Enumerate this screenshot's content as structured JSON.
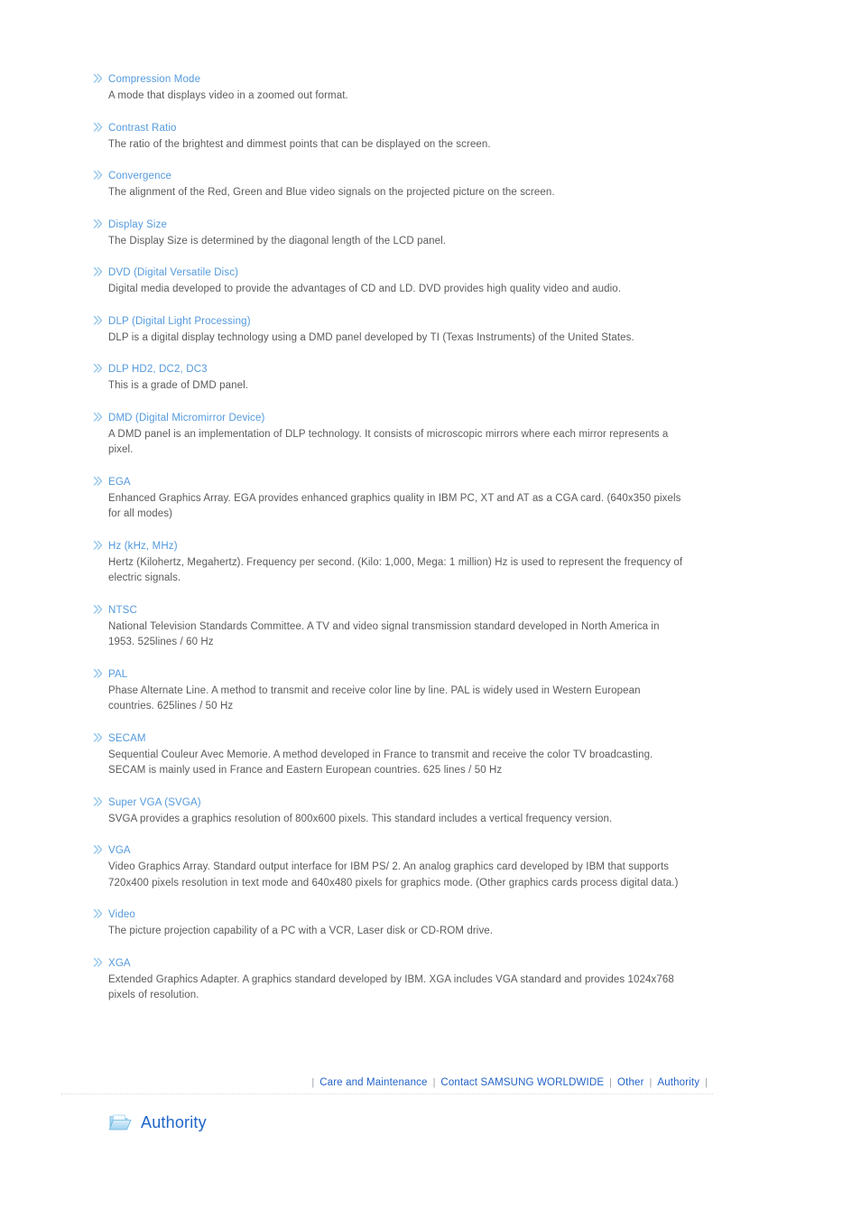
{
  "glossary": {
    "entries": [
      {
        "term": "Compression Mode",
        "definition": "A mode that displays video in a zoomed out format."
      },
      {
        "term": "Contrast Ratio",
        "definition": "The ratio of the brightest and dimmest points that can be displayed on the screen."
      },
      {
        "term": "Convergence",
        "definition": "The alignment of the Red, Green and Blue video signals on the projected picture on the screen."
      },
      {
        "term": "Display Size",
        "definition": "The Display Size is determined by the diagonal length of the LCD panel."
      },
      {
        "term": "DVD (Digital Versatile Disc)",
        "definition": "Digital media developed to provide the advantages of CD and LD. DVD provides high quality video and audio."
      },
      {
        "term": "DLP (Digital Light Processing)",
        "definition": "DLP is a digital display technology using a DMD panel developed by TI (Texas Instruments) of the United States."
      },
      {
        "term": "DLP HD2, DC2, DC3",
        "definition": "This is a grade of DMD panel."
      },
      {
        "term": "DMD (Digital Micromirror Device)",
        "definition": "A DMD panel is an implementation of DLP technology. It consists of microscopic mirrors where each mirror represents a pixel."
      },
      {
        "term": "EGA",
        "definition": "Enhanced Graphics Array. EGA provides enhanced graphics quality in IBM PC, XT and AT as a CGA card. (640x350 pixels for all modes)"
      },
      {
        "term": "Hz (kHz, MHz)",
        "definition": "Hertz (Kilohertz, Megahertz). Frequency per second. (Kilo: 1,000, Mega: 1 million) Hz is used to represent the frequency of electric signals."
      },
      {
        "term": "NTSC",
        "definition": "National Television Standards Committee. A TV and video signal transmission standard developed in North America in 1953. 525lines / 60 Hz"
      },
      {
        "term": "PAL",
        "definition": "Phase Alternate Line. A method to transmit and receive color line by line. PAL is widely used in Western European countries. 625lines / 50 Hz"
      },
      {
        "term": "SECAM",
        "definition": "Sequential Couleur Avec Memorie. A method developed in France to transmit and receive the color TV broadcasting. SECAM is mainly used in France and Eastern European countries. 625 lines / 50 Hz"
      },
      {
        "term": "Super VGA (SVGA)",
        "definition": "SVGA provides a graphics resolution of 800x600 pixels. This standard includes a vertical frequency version."
      },
      {
        "term": "VGA",
        "definition": "Video Graphics Array. Standard output interface for IBM PS/ 2. An analog graphics card developed by IBM that supports 720x400 pixels resolution in text mode and 640x480 pixels for graphics mode. (Other graphics cards process digital data.)"
      },
      {
        "term": "Video",
        "definition": "The picture projection capability of a PC with a VCR, Laser disk or CD-ROM drive."
      },
      {
        "term": "XGA",
        "definition": "Extended Graphics Adapter. A graphics standard developed by IBM. XGA includes VGA standard and provides 1024x768 pixels of resolution."
      }
    ],
    "bullet_icon": "double-chevron-icon"
  },
  "footer_nav": {
    "separator": "|",
    "links": [
      {
        "label": "Care and Maintenance"
      },
      {
        "label": "Contact SAMSUNG WORLDWIDE"
      },
      {
        "label": "Other"
      },
      {
        "label": "Authority"
      }
    ]
  },
  "section": {
    "icon": "folder-icon",
    "title": "Authority"
  },
  "colors": {
    "term_blue": "#549add",
    "body_gray": "#5a5a5a",
    "link_blue": "#2363c8",
    "title_blue": "#1e65c8",
    "separator_gray": "#9aa0a6",
    "rule_gray": "#dcdcdc",
    "background": "#ffffff"
  }
}
